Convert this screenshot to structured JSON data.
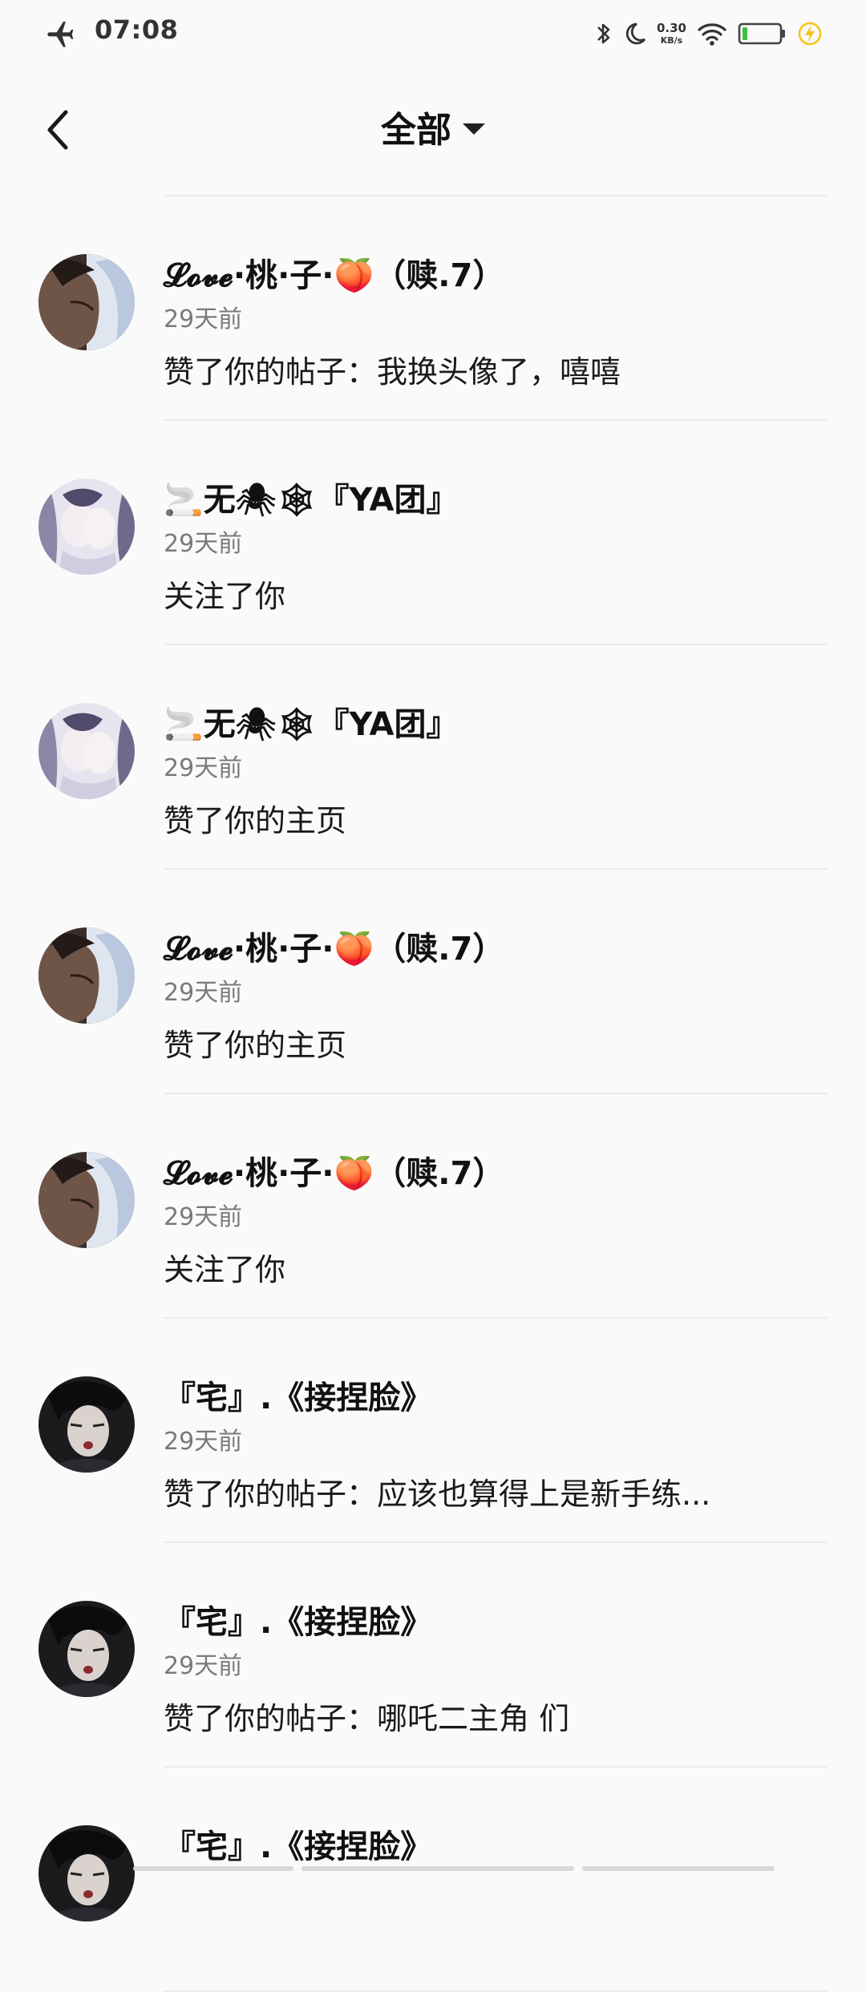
{
  "status_bar": {
    "time": "07:08",
    "net_speed_value": "0.30",
    "net_speed_unit": "KB/s",
    "icons": [
      "airplane-icon",
      "bluetooth-icon",
      "moon-icon",
      "wifi-icon",
      "battery-icon",
      "charging-icon"
    ]
  },
  "header": {
    "title": "全部",
    "back_icon": "chevron-left-icon",
    "dropdown_icon": "caret-down-icon"
  },
  "notifications": [
    {
      "user": "𝓛𝓸𝓿𝓮·桃·子·🍑（赎.7）",
      "time": "29天前",
      "action": "赞了你的帖子：我换头像了，嘻嘻",
      "avatar": "avatar-a"
    },
    {
      "user": "🚬无🕷🕸『YA团』",
      "time": "29天前",
      "action": "关注了你",
      "avatar": "avatar-b"
    },
    {
      "user": "🚬无🕷🕸『YA团』",
      "time": "29天前",
      "action": "赞了你的主页",
      "avatar": "avatar-b"
    },
    {
      "user": "𝓛𝓸𝓿𝓮·桃·子·🍑（赎.7）",
      "time": "29天前",
      "action": "赞了你的主页",
      "avatar": "avatar-a"
    },
    {
      "user": "𝓛𝓸𝓿𝓮·桃·子·🍑（赎.7）",
      "time": "29天前",
      "action": "关注了你",
      "avatar": "avatar-a"
    },
    {
      "user": "『宅』.《接捏脸》",
      "time": "29天前",
      "action": "赞了你的帖子：应该也算得上是新手练...",
      "avatar": "avatar-c"
    },
    {
      "user": "『宅』.《接捏脸》",
      "time": "29天前",
      "action": "赞了你的帖子：哪吒二主角 们",
      "avatar": "avatar-c"
    },
    {
      "user": "『宅』.《接捏脸》",
      "time": "",
      "action": "",
      "avatar": "avatar-c"
    }
  ],
  "colors": {
    "background": "#fbfafb",
    "divider": "#ececec",
    "secondary_text": "#7a7a7a",
    "battery_green": "#3fbf3f",
    "charging_yellow": "#f5c518"
  }
}
